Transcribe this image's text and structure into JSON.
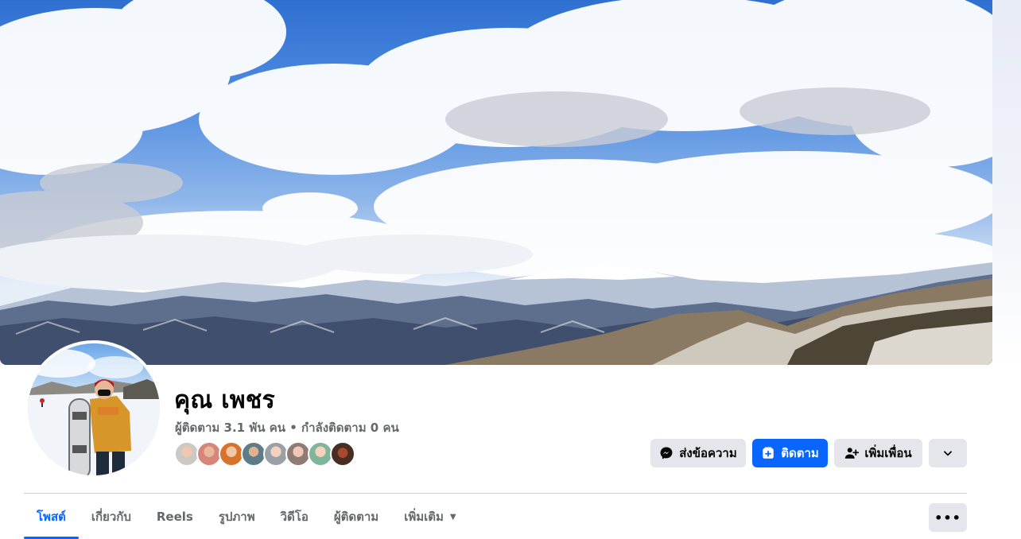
{
  "profile": {
    "name": "คุณ เพชร",
    "stats": "ผู้ติดตาม 3.1 พัน คน • กำลังติดตาม 0 คน"
  },
  "actions": {
    "message_label": "ส่งข้อความ",
    "follow_label": "ติดตาม",
    "add_friend_label": "เพิ่มเพื่อน"
  },
  "tabs": [
    {
      "label": "โพสต์",
      "active": true
    },
    {
      "label": "เกี่ยวกับ",
      "active": false
    },
    {
      "label": "Reels",
      "active": false
    },
    {
      "label": "รูปภาพ",
      "active": false
    },
    {
      "label": "วิดีโอ",
      "active": false
    },
    {
      "label": "ผู้ติดตาม",
      "active": false
    },
    {
      "label": "เพิ่มเติม",
      "active": false
    }
  ],
  "more_menu_label": "•••",
  "colors": {
    "accent": "#0866ff",
    "button_gray": "#e4e6eb",
    "secondary_text": "#65676b"
  },
  "icons": {
    "message": "messenger-icon",
    "follow": "follow-icon",
    "add_friend": "add-friend-icon",
    "dropdown": "chevron-down-icon",
    "tab_more": "caret-down-icon"
  }
}
